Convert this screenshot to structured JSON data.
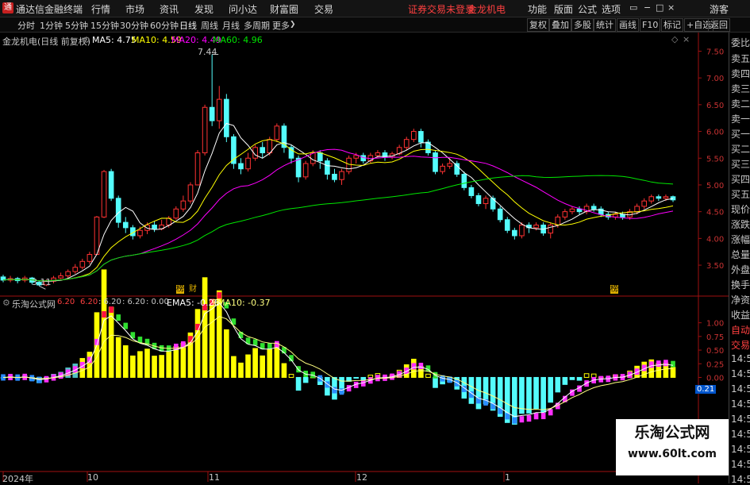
{
  "menubar": {
    "app_title": "通达信金融终端",
    "logo_char": "通",
    "menus": [
      "行情",
      "市场",
      "资讯",
      "发现",
      "问小达",
      "财富圈",
      "交易"
    ],
    "status": "证券交易未登录",
    "stock": "金龙机电",
    "right": [
      "功能",
      "版面",
      "公式",
      "选项"
    ],
    "guest": "游客"
  },
  "toolbar": {
    "periods": [
      "分时",
      "1分钟",
      "5分钟",
      "15分钟",
      "30分钟",
      "60分钟",
      "日线",
      "周线",
      "月线",
      "多周期",
      "更多"
    ],
    "selected": "日线",
    "right": [
      "复权",
      "叠加",
      "多股",
      "统计",
      "画线",
      "F10",
      "标记",
      "+自选",
      "返回"
    ]
  },
  "main": {
    "title": "金龙机电(日线 前复权)",
    "ma5": "MA5: 4.75",
    "ma10": "MA10: 4.59",
    "ma20": "MA20: 4.49",
    "ma60": "MA60: 4.96",
    "high_label": "7.44",
    "low_label": "3.11",
    "event1": "榜",
    "event2": "财",
    "event3": "榜",
    "colors": {
      "up": "#ff3232",
      "down": "#54fcfc",
      "ma5": "#ffffff",
      "ma10": "#ffff00",
      "ma20": "#ff00ff",
      "ma60": "#00e600"
    }
  },
  "sub": {
    "title": "乐淘公式网",
    "p1": "6.20",
    "p2": "6.20",
    "p3": ": 6.20",
    "p4": ": 6.20",
    "p5": ": 0.00",
    "ema5": "EMA5: -0.26",
    "ema10": "EMA10: -0.37",
    "cur_value": "0.21"
  },
  "xaxis": [
    "2024年",
    "10",
    "11",
    "12",
    "1"
  ],
  "rightpanel": [
    "委比",
    "卖五",
    "卖四",
    "卖三",
    "卖二",
    "卖一",
    "买一",
    "买二",
    "买三",
    "买四",
    "买五",
    "现价",
    "涨跌",
    "涨幅",
    "总量",
    "外盘",
    "换手",
    "净资",
    "收益",
    "自动",
    "交易",
    "14:56",
    "14:56",
    "14:56",
    "14:56",
    "14:56",
    "14:56",
    "14:56",
    "14:56",
    "14:56"
  ],
  "watermark": {
    "title": "乐淘公式网",
    "url": "www.60lt.com"
  },
  "chart_data": [
    {
      "type": "candlestick",
      "title": "金龙机电(日线 前复权)",
      "ylim": [
        3.1,
        7.7
      ],
      "yticks": [
        3.5,
        4.0,
        4.5,
        5.0,
        5.5,
        6.0,
        6.5,
        7.0,
        7.5
      ],
      "annotations": [
        "7.44",
        "3.11"
      ],
      "candles": [
        [
          3.28,
          3.22,
          3.32,
          3.18
        ],
        [
          3.22,
          3.25,
          3.3,
          3.18
        ],
        [
          3.25,
          3.21,
          3.28,
          3.16
        ],
        [
          3.22,
          3.26,
          3.3,
          3.18
        ],
        [
          3.26,
          3.18,
          3.28,
          3.14
        ],
        [
          3.18,
          3.13,
          3.2,
          3.11
        ],
        [
          3.13,
          3.2,
          3.23,
          3.11
        ],
        [
          3.2,
          3.26,
          3.3,
          3.16
        ],
        [
          3.26,
          3.3,
          3.36,
          3.24
        ],
        [
          3.3,
          3.38,
          3.42,
          3.26
        ],
        [
          3.38,
          3.46,
          3.52,
          3.34
        ],
        [
          3.46,
          3.57,
          3.62,
          3.42
        ],
        [
          3.57,
          3.7,
          3.75,
          3.52
        ],
        [
          3.7,
          4.4,
          4.42,
          3.7
        ],
        [
          4.4,
          5.25,
          5.28,
          4.38
        ],
        [
          5.25,
          4.75,
          5.3,
          4.7
        ],
        [
          4.75,
          4.3,
          4.8,
          4.2
        ],
        [
          4.3,
          4.2,
          4.4,
          4.1
        ],
        [
          4.2,
          4.05,
          4.25,
          3.98
        ],
        [
          4.05,
          4.15,
          4.22,
          4.0
        ],
        [
          4.15,
          4.25,
          4.3,
          4.08
        ],
        [
          4.25,
          4.18,
          4.32,
          4.12
        ],
        [
          4.18,
          4.25,
          4.35,
          4.15
        ],
        [
          4.25,
          4.38,
          4.42,
          4.2
        ],
        [
          4.38,
          4.55,
          4.6,
          4.35
        ],
        [
          4.55,
          4.7,
          4.8,
          4.5
        ],
        [
          4.7,
          5.0,
          5.05,
          4.65
        ],
        [
          5.0,
          5.6,
          5.65,
          5.0
        ],
        [
          5.6,
          6.45,
          6.5,
          5.55
        ],
        [
          6.45,
          6.2,
          7.44,
          6.1
        ],
        [
          6.2,
          6.6,
          6.85,
          6.05
        ],
        [
          6.6,
          5.9,
          6.7,
          5.8
        ],
        [
          5.9,
          5.4,
          5.95,
          5.3
        ],
        [
          5.4,
          5.3,
          5.5,
          5.2
        ],
        [
          5.3,
          5.5,
          5.6,
          5.25
        ],
        [
          5.5,
          5.7,
          5.75,
          5.45
        ],
        [
          5.7,
          5.6,
          5.8,
          5.5
        ],
        [
          5.6,
          5.85,
          5.9,
          5.55
        ],
        [
          5.85,
          6.1,
          6.15,
          5.8
        ],
        [
          6.1,
          5.7,
          6.15,
          5.6
        ],
        [
          5.7,
          5.5,
          5.75,
          5.4
        ],
        [
          5.5,
          5.15,
          5.55,
          5.05
        ],
        [
          5.15,
          5.4,
          5.45,
          5.1
        ],
        [
          5.4,
          5.6,
          5.65,
          5.35
        ],
        [
          5.6,
          5.45,
          5.65,
          5.3
        ],
        [
          5.45,
          5.2,
          5.5,
          5.1
        ],
        [
          5.2,
          5.1,
          5.3,
          5.05
        ],
        [
          5.1,
          5.25,
          5.3,
          5.0
        ],
        [
          5.25,
          5.5,
          5.55,
          5.2
        ],
        [
          5.5,
          5.55,
          5.6,
          5.4
        ],
        [
          5.55,
          5.45,
          5.6,
          5.4
        ],
        [
          5.45,
          5.55,
          5.6,
          5.4
        ],
        [
          5.55,
          5.6,
          5.65,
          5.5
        ],
        [
          5.6,
          5.52,
          5.65,
          5.45
        ],
        [
          5.52,
          5.58,
          5.62,
          5.48
        ],
        [
          5.58,
          5.7,
          5.75,
          5.55
        ],
        [
          5.7,
          5.85,
          5.9,
          5.65
        ],
        [
          5.85,
          6.0,
          6.05,
          5.8
        ],
        [
          6.0,
          5.8,
          6.05,
          5.7
        ],
        [
          5.8,
          5.6,
          5.85,
          5.55
        ],
        [
          5.6,
          5.25,
          5.65,
          5.2
        ],
        [
          5.25,
          5.35,
          5.4,
          5.2
        ],
        [
          5.35,
          5.4,
          5.5,
          5.3
        ],
        [
          5.4,
          5.2,
          5.45,
          5.15
        ],
        [
          5.2,
          4.95,
          5.25,
          4.9
        ],
        [
          4.95,
          4.8,
          5.0,
          4.75
        ],
        [
          4.8,
          4.65,
          4.85,
          4.6
        ],
        [
          4.65,
          4.75,
          4.8,
          4.55
        ],
        [
          4.75,
          4.55,
          4.8,
          4.5
        ],
        [
          4.55,
          4.35,
          4.6,
          4.3
        ],
        [
          4.35,
          4.15,
          4.4,
          4.1
        ],
        [
          4.15,
          4.05,
          4.2,
          3.98
        ],
        [
          4.05,
          4.25,
          4.3,
          4.0
        ],
        [
          4.25,
          4.2,
          4.3,
          4.1
        ],
        [
          4.2,
          4.25,
          4.3,
          4.15
        ],
        [
          4.25,
          4.1,
          4.3,
          4.05
        ],
        [
          4.1,
          4.25,
          4.3,
          4.0
        ],
        [
          4.25,
          4.4,
          4.45,
          4.2
        ],
        [
          4.4,
          4.5,
          4.55,
          4.35
        ],
        [
          4.5,
          4.55,
          4.6,
          4.45
        ],
        [
          4.55,
          4.5,
          4.6,
          4.45
        ],
        [
          4.5,
          4.6,
          4.65,
          4.45
        ],
        [
          4.6,
          4.55,
          4.65,
          4.5
        ],
        [
          4.55,
          4.45,
          4.6,
          4.4
        ],
        [
          4.45,
          4.4,
          4.5,
          4.35
        ],
        [
          4.4,
          4.45,
          4.5,
          4.35
        ],
        [
          4.45,
          4.4,
          4.5,
          4.35
        ],
        [
          4.4,
          4.5,
          4.55,
          4.35
        ],
        [
          4.5,
          4.6,
          4.65,
          4.45
        ],
        [
          4.6,
          4.7,
          4.75,
          4.55
        ],
        [
          4.7,
          4.78,
          4.82,
          4.65
        ],
        [
          4.78,
          4.75,
          4.82,
          4.7
        ],
        [
          4.75,
          4.78,
          4.82,
          4.7
        ],
        [
          4.78,
          4.72,
          4.8,
          4.68
        ]
      ]
    },
    {
      "type": "bar+line",
      "title": "乐淘公式网",
      "ylim": [
        -1.65,
        1.3
      ],
      "yticks": [
        0.0,
        0.25,
        0.5,
        0.75,
        1.0
      ],
      "current": 0.21,
      "ema5_last": -0.26,
      "ema10_last": -0.37
    }
  ]
}
